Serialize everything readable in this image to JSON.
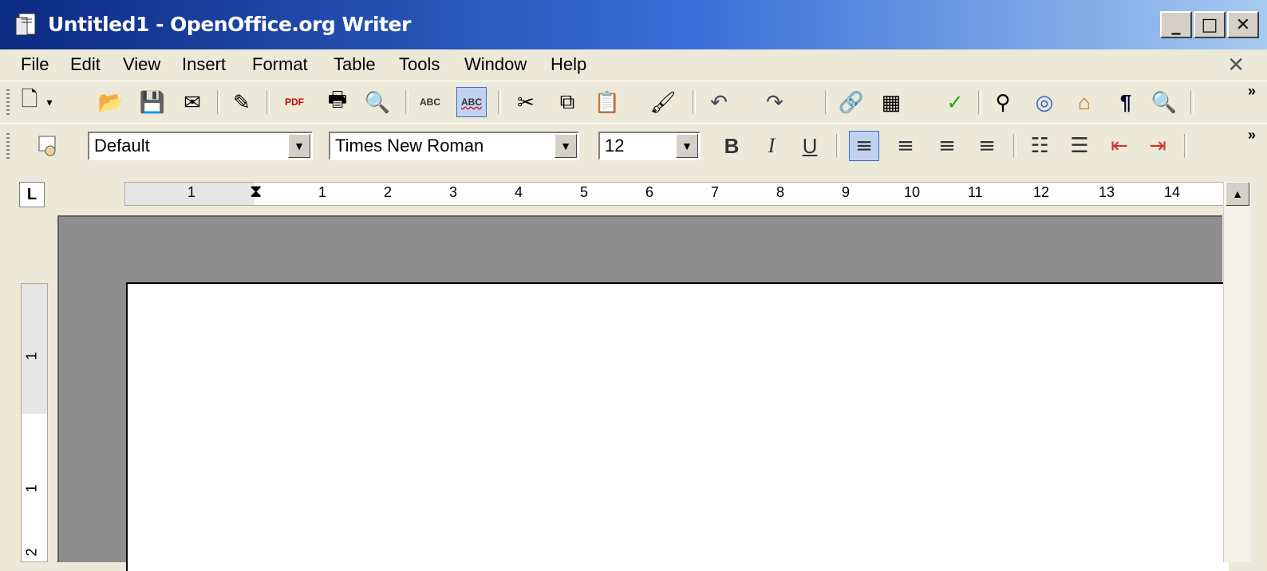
{
  "window": {
    "title": "Untitled1 - OpenOffice.org Writer",
    "minimize": "_",
    "maximize": "□",
    "close": "✕"
  },
  "menu": {
    "items": [
      {
        "label": "File"
      },
      {
        "label": "Edit"
      },
      {
        "label": "View"
      },
      {
        "label": "Insert"
      },
      {
        "label": "Format"
      },
      {
        "label": "Table"
      },
      {
        "label": "Tools"
      },
      {
        "label": "Window"
      },
      {
        "label": "Help"
      }
    ],
    "close_doc": "✕"
  },
  "standard_toolbar": {
    "buttons": [
      {
        "name": "new-document",
        "icon": "🗋"
      },
      {
        "name": "new-dropdown",
        "icon": "▾"
      },
      {
        "name": "open",
        "icon": "📂"
      },
      {
        "name": "save",
        "icon": "💾"
      },
      {
        "name": "email",
        "icon": "✉"
      },
      {
        "name": "edit-file",
        "icon": "✎"
      },
      {
        "name": "export-pdf",
        "icon": "PDF"
      },
      {
        "name": "print",
        "icon": "🖶"
      },
      {
        "name": "print-preview",
        "icon": "🔍"
      },
      {
        "name": "spellcheck",
        "icon": "ABC"
      },
      {
        "name": "autospellcheck",
        "icon": "ABC"
      },
      {
        "name": "cut",
        "icon": "✂"
      },
      {
        "name": "copy",
        "icon": "⧉"
      },
      {
        "name": "paste",
        "icon": "📋"
      },
      {
        "name": "clone-formatting",
        "icon": "🖌"
      },
      {
        "name": "undo",
        "icon": "↶"
      },
      {
        "name": "redo",
        "icon": "↷"
      },
      {
        "name": "hyperlink",
        "icon": "🔗"
      },
      {
        "name": "table",
        "icon": "▦"
      },
      {
        "name": "show-draw-functions",
        "icon": "✓"
      },
      {
        "name": "find-replace",
        "icon": "⚲"
      },
      {
        "name": "navigator",
        "icon": "◎"
      },
      {
        "name": "gallery",
        "icon": "⌂"
      },
      {
        "name": "nonprinting-chars",
        "icon": "¶"
      },
      {
        "name": "zoom",
        "icon": "🔍"
      }
    ],
    "overflow": "»"
  },
  "format_toolbar": {
    "style_value": "Default",
    "font_value": "Times New Roman",
    "size_value": "12",
    "bold": "B",
    "italic": "I",
    "underline": "U",
    "align_left": "≡",
    "align_center": "≡",
    "align_right": "≡",
    "justify": "≡",
    "numbering": "☷",
    "bullets": "☰",
    "decrease_indent": "⇤",
    "increase_indent": "⇥",
    "overflow": "»"
  },
  "ruler": {
    "corner": "L",
    "h_labels": [
      "1",
      "1",
      "2",
      "3",
      "4",
      "5",
      "6",
      "7",
      "8",
      "9",
      "10",
      "11",
      "12",
      "13",
      "14"
    ],
    "v_labels": [
      "1",
      "1",
      "2"
    ]
  },
  "colors": {
    "title_start": "#0b2a82",
    "title_end": "#a6caf0",
    "face": "#ece9d8",
    "canvas": "#8e8e8e"
  }
}
